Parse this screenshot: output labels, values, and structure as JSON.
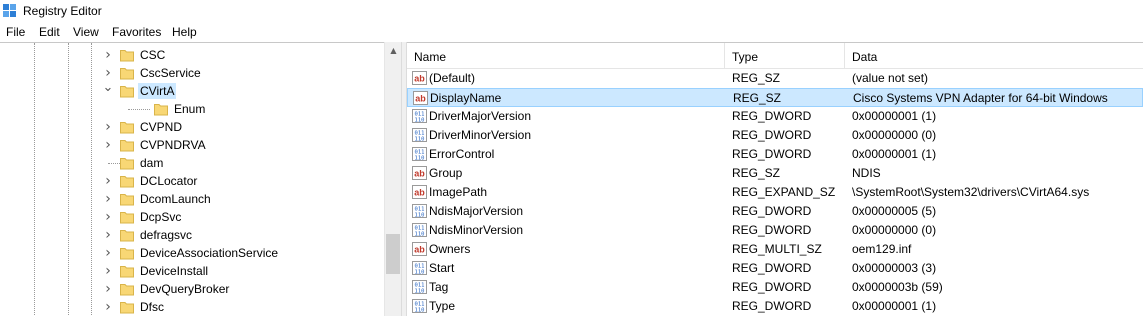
{
  "window": {
    "title": "Registry Editor",
    "icon": "registry-editor-icon"
  },
  "menu": [
    "File",
    "Edit",
    "View",
    "Favorites",
    "Help"
  ],
  "tree": {
    "items": [
      {
        "label": "CSC",
        "level": 1,
        "expander": "collapsed"
      },
      {
        "label": "CscService",
        "level": 1,
        "expander": "collapsed"
      },
      {
        "label": "CVirtA",
        "level": 1,
        "expander": "expanded",
        "selected": true
      },
      {
        "label": "Enum",
        "level": 2,
        "expander": "none"
      },
      {
        "label": "CVPND",
        "level": 1,
        "expander": "collapsed"
      },
      {
        "label": "CVPNDRVA",
        "level": 1,
        "expander": "collapsed"
      },
      {
        "label": "dam",
        "level": 1,
        "expander": "none"
      },
      {
        "label": "DCLocator",
        "level": 1,
        "expander": "collapsed"
      },
      {
        "label": "DcomLaunch",
        "level": 1,
        "expander": "collapsed"
      },
      {
        "label": "DcpSvc",
        "level": 1,
        "expander": "collapsed"
      },
      {
        "label": "defragsvc",
        "level": 1,
        "expander": "collapsed"
      },
      {
        "label": "DeviceAssociationService",
        "level": 1,
        "expander": "collapsed"
      },
      {
        "label": "DeviceInstall",
        "level": 1,
        "expander": "collapsed"
      },
      {
        "label": "DevQueryBroker",
        "level": 1,
        "expander": "collapsed"
      },
      {
        "label": "Dfsc",
        "level": 1,
        "expander": "collapsed"
      }
    ]
  },
  "list": {
    "columns": {
      "name": "Name",
      "type": "Type",
      "data": "Data"
    },
    "rows": [
      {
        "icon": "string-value-icon",
        "name": "(Default)",
        "type": "REG_SZ",
        "data": "(value not set)"
      },
      {
        "icon": "string-value-icon",
        "name": "DisplayName",
        "type": "REG_SZ",
        "data": "Cisco Systems VPN Adapter for 64-bit Windows",
        "selected": true
      },
      {
        "icon": "binary-value-icon",
        "name": "DriverMajorVersion",
        "type": "REG_DWORD",
        "data": "0x00000001 (1)"
      },
      {
        "icon": "binary-value-icon",
        "name": "DriverMinorVersion",
        "type": "REG_DWORD",
        "data": "0x00000000 (0)"
      },
      {
        "icon": "binary-value-icon",
        "name": "ErrorControl",
        "type": "REG_DWORD",
        "data": "0x00000001 (1)"
      },
      {
        "icon": "string-value-icon",
        "name": "Group",
        "type": "REG_SZ",
        "data": "NDIS"
      },
      {
        "icon": "string-value-icon",
        "name": "ImagePath",
        "type": "REG_EXPAND_SZ",
        "data": "\\SystemRoot\\System32\\drivers\\CVirtA64.sys"
      },
      {
        "icon": "binary-value-icon",
        "name": "NdisMajorVersion",
        "type": "REG_DWORD",
        "data": "0x00000005 (5)"
      },
      {
        "icon": "binary-value-icon",
        "name": "NdisMinorVersion",
        "type": "REG_DWORD",
        "data": "0x00000000 (0)"
      },
      {
        "icon": "string-value-icon",
        "name": "Owners",
        "type": "REG_MULTI_SZ",
        "data": "oem129.inf"
      },
      {
        "icon": "binary-value-icon",
        "name": "Start",
        "type": "REG_DWORD",
        "data": "0x00000003 (3)"
      },
      {
        "icon": "binary-value-icon",
        "name": "Tag",
        "type": "REG_DWORD",
        "data": "0x0000003b (59)"
      },
      {
        "icon": "binary-value-icon",
        "name": "Type",
        "type": "REG_DWORD",
        "data": "0x00000001 (1)"
      }
    ]
  },
  "colors": {
    "selection": "#cce8ff",
    "selection_border": "#99d1ff",
    "folder": "#f8d775",
    "string_icon": "#c0392b",
    "binary_icon": "#1f5fbf"
  }
}
